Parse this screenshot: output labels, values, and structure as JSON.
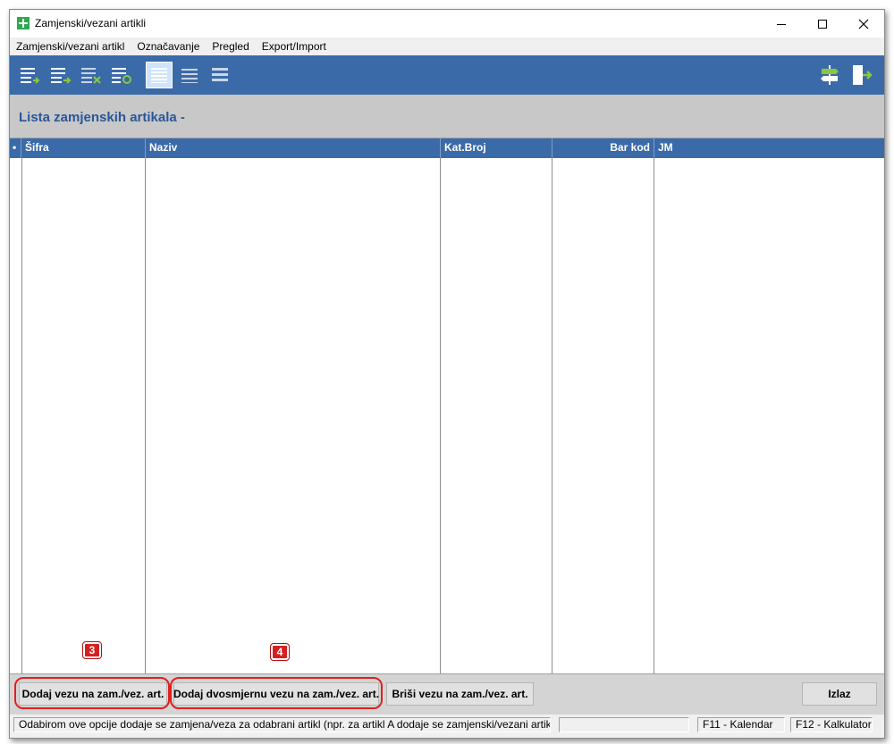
{
  "window": {
    "title": "Zamjenski/vezani artikli",
    "minimize_label": "—",
    "maximize_label": "☐",
    "close_label": "✕"
  },
  "menubar": {
    "items": [
      "Zamjenski/vezani artikl",
      "Označavanje",
      "Pregled",
      "Export/Import"
    ]
  },
  "toolbar": {
    "icons": [
      "list-add-icon",
      "list-insert-icon",
      "list-delete-icon",
      "list-refresh-icon",
      "view-list-active-icon",
      "view-list-icon",
      "view-list-compact-icon",
      "signpost-icon",
      "exit-icon"
    ],
    "accent": "#8dc63f"
  },
  "banner": {
    "title": "Lista zamjenskih artikala -"
  },
  "grid": {
    "columns": [
      {
        "key": "marker",
        "label": "•"
      },
      {
        "key": "sifra",
        "label": "Šifra"
      },
      {
        "key": "naziv",
        "label": "Naziv"
      },
      {
        "key": "katbroj",
        "label": "Kat.Broj"
      },
      {
        "key": "barkod",
        "label": "Bar kod"
      },
      {
        "key": "jm",
        "label": "JM"
      }
    ],
    "rows": []
  },
  "buttons": {
    "dodaj_vezu": "Dodaj vezu na zam./vez. art.",
    "dodaj_dvosmjernu": "Dodaj dvosmjernu vezu na zam./vez. art.",
    "brisi_vezu": "Briši vezu na zam./vez. art.",
    "izlaz": "Izlaz"
  },
  "badges": {
    "first": "3",
    "second": "4"
  },
  "statusbar": {
    "hint": "Odabirom ove opcije dodaje se zamjena/veza za odabrani artikl (npr. za artikl A dodaje se zamjenski/vezani artikl B)",
    "empty": "",
    "f11": "F11 - Kalendar",
    "f12": "F12 - Kalkulator"
  },
  "colors": {
    "header_blue": "#3b6aa8",
    "title_blue": "#2a5699",
    "highlight_red": "#e02020",
    "app_icon_green": "#2fa84f"
  }
}
